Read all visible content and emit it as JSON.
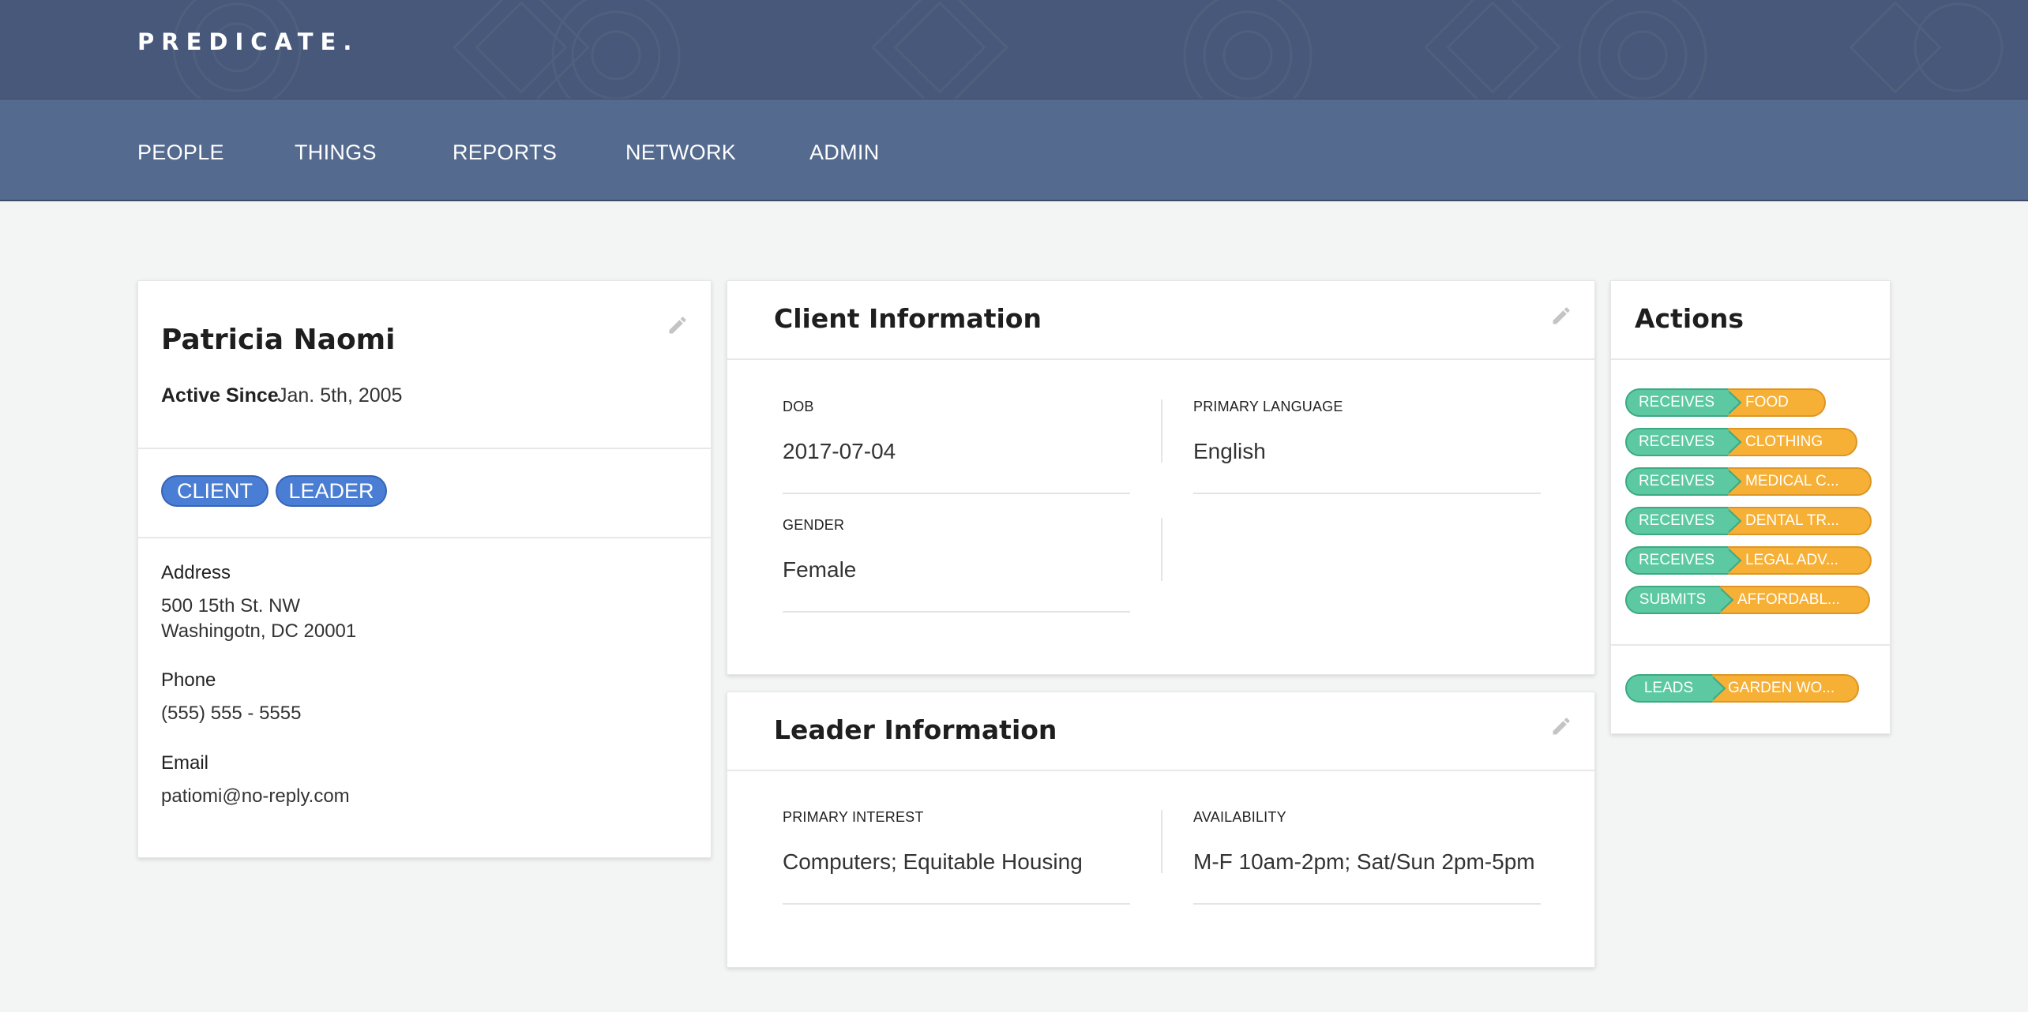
{
  "header": {
    "logo": "PREDICATE.",
    "colors": {
      "topbar": "#48587a",
      "navbar": "#546a8e"
    }
  },
  "nav": {
    "items": [
      {
        "label": "PEOPLE"
      },
      {
        "label": "THINGS"
      },
      {
        "label": "REPORTS"
      },
      {
        "label": "NETWORK"
      },
      {
        "label": "ADMIN"
      }
    ]
  },
  "profile": {
    "name": "Patricia Naomi",
    "active_since_label": "Active Since",
    "active_since_value": "Jan. 5th, 2005",
    "tags": [
      "CLIENT",
      "LEADER"
    ],
    "address_label": "Address",
    "address_line1": "500 15th St. NW",
    "address_line2": "Washingotn, DC 20001",
    "phone_label": "Phone",
    "phone_value": "(555) 555 - 5555",
    "email_label": "Email",
    "email_value": "patiomi@no-reply.com",
    "edit_icon": "pencil-icon"
  },
  "client_info": {
    "title": "Client Information",
    "dob_label": "DOB",
    "dob_value": "2017-07-04",
    "language_label": "PRIMARY LANGUAGE",
    "language_value": "English",
    "gender_label": "GENDER",
    "gender_value": "Female",
    "edit_icon": "pencil-icon"
  },
  "leader_info": {
    "title": "Leader Information",
    "interest_label": "PRIMARY INTEREST",
    "interest_value": "Computers; Equitable Housing",
    "availability_label": "AVAILABILITY",
    "availability_value": "M-F 10am-2pm; Sat/Sun 2pm-5pm",
    "edit_icon": "pencil-icon"
  },
  "actions": {
    "title": "Actions",
    "items": [
      {
        "verb": "RECEIVES",
        "object": "FOOD"
      },
      {
        "verb": "RECEIVES",
        "object": "CLOTHING"
      },
      {
        "verb": "RECEIVES",
        "object": "MEDICAL C..."
      },
      {
        "verb": "RECEIVES",
        "object": "DENTAL TR..."
      },
      {
        "verb": "RECEIVES",
        "object": "LEGAL ADV..."
      },
      {
        "verb": "SUBMITS",
        "object": "AFFORDABL..."
      }
    ],
    "lead_items": [
      {
        "verb": "LEADS",
        "object": "GARDEN WO..."
      }
    ],
    "colors": {
      "verb": "#5cc9a2",
      "object": "#f6b036",
      "tag": "#4a7dd4"
    }
  }
}
